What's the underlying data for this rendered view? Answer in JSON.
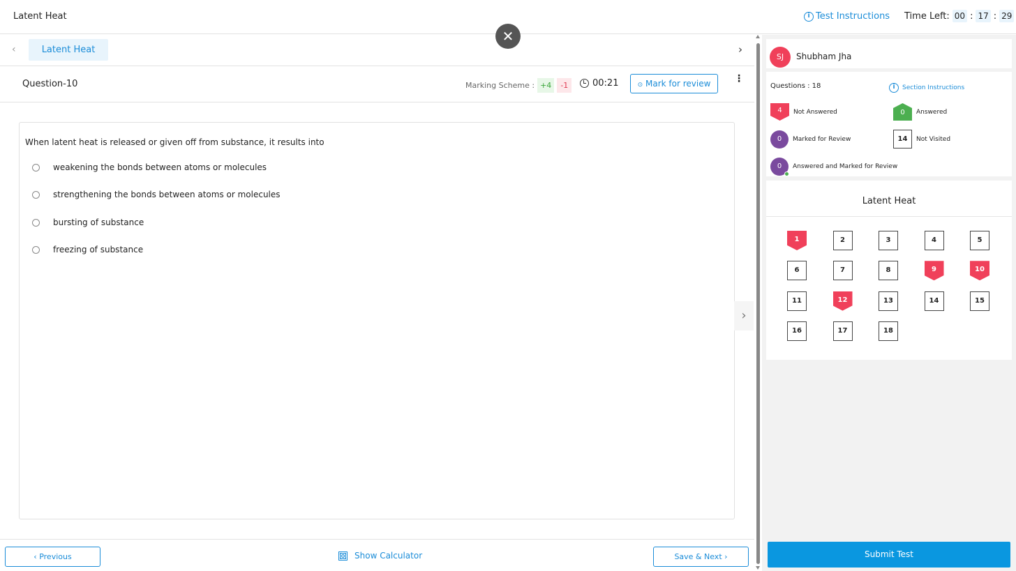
{
  "header": {
    "title": "Latent Heat",
    "instructions_label": "Test Instructions",
    "instructions_icon": "info-icon",
    "time_left_label": "Time Left:",
    "hours": "00",
    "minutes": "17",
    "seconds": "29",
    "sep": ":"
  },
  "close_label": "✕",
  "section_tab": {
    "label": "Latent Heat",
    "prev": "‹",
    "next": "›"
  },
  "question_bar": {
    "question_label": "Question-10",
    "marking_label": "Marking Scheme :",
    "positive": "+4",
    "negative": "-1",
    "time_spent": "00:21",
    "mark_review_label": "Mark for review",
    "more_icon": "⋮"
  },
  "question": {
    "text": "When latent heat is released or given off from substance, it results into",
    "options": [
      "weakening the bonds between atoms or molecules",
      "strengthening the bonds between atoms or molecules",
      "bursting of substance",
      "freezing of substance"
    ]
  },
  "footer": {
    "previous_label": "Previous",
    "calculator_label": "Show Calculator",
    "save_next_label": "Save & Next"
  },
  "side_arrow": "›",
  "user": {
    "initials": "SJ",
    "name": "Shubham Jha"
  },
  "summary": {
    "questions_label": "Questions : 18",
    "section_instructions_label": "Section Instructions",
    "not_answered_count": "4",
    "not_answered_label": "Not Answered",
    "answered_count": "0",
    "answered_label": "Answered",
    "marked_count": "0",
    "marked_label": "Marked for Review",
    "not_visited_count": "14",
    "not_visited_label": "Not Visited",
    "answered_marked_count": "0",
    "answered_marked_label": "Answered and Marked for Review"
  },
  "palette": {
    "title": "Latent Heat",
    "questions": [
      {
        "n": "1",
        "status": "not-answered"
      },
      {
        "n": "2",
        "status": "not-visited"
      },
      {
        "n": "3",
        "status": "not-visited"
      },
      {
        "n": "4",
        "status": "not-visited"
      },
      {
        "n": "5",
        "status": "not-visited"
      },
      {
        "n": "6",
        "status": "not-visited"
      },
      {
        "n": "7",
        "status": "not-visited"
      },
      {
        "n": "8",
        "status": "not-visited"
      },
      {
        "n": "9",
        "status": "not-answered"
      },
      {
        "n": "10",
        "status": "not-answered"
      },
      {
        "n": "11",
        "status": "not-visited"
      },
      {
        "n": "12",
        "status": "not-answered"
      },
      {
        "n": "13",
        "status": "not-visited"
      },
      {
        "n": "14",
        "status": "not-visited"
      },
      {
        "n": "15",
        "status": "not-visited"
      },
      {
        "n": "16",
        "status": "not-visited"
      },
      {
        "n": "17",
        "status": "not-visited"
      },
      {
        "n": "18",
        "status": "not-visited"
      }
    ]
  },
  "submit_label": "Submit Test",
  "colors": {
    "accent": "#1a8cd8",
    "not_answered": "#f0405a",
    "answered": "#4caf50",
    "marked": "#7a4a9e",
    "submit": "#0a97e0"
  }
}
